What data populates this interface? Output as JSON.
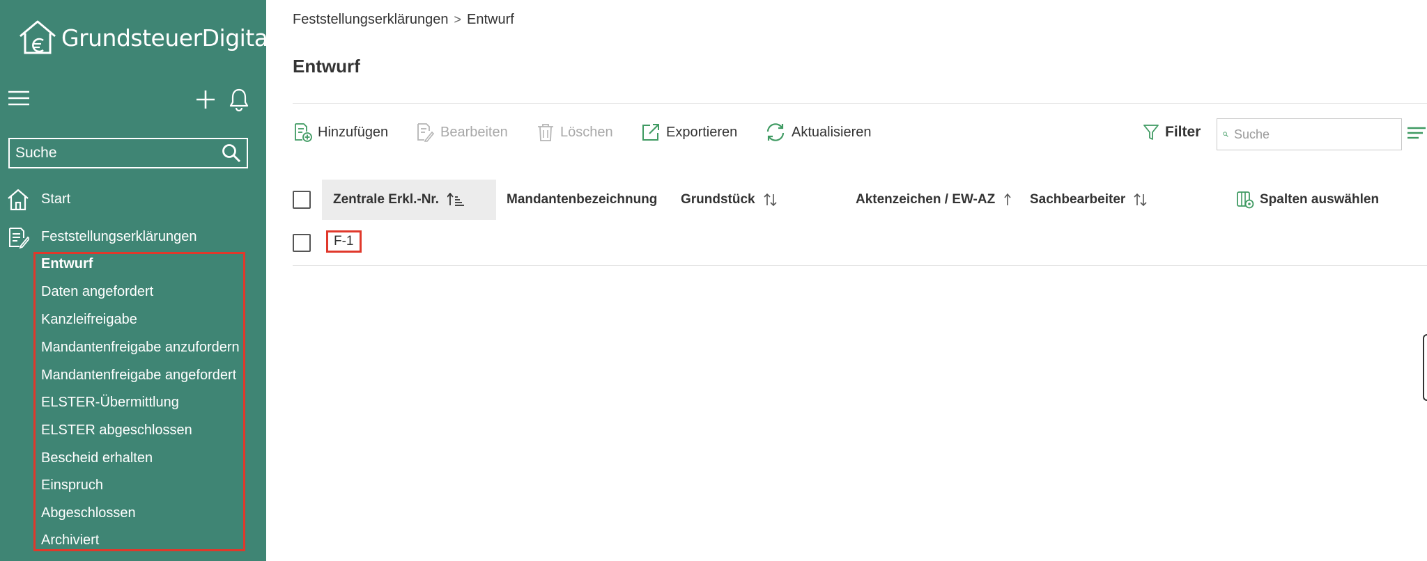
{
  "app": {
    "logo_text": "GrundsteuerDigital"
  },
  "sidebar": {
    "search_placeholder": "Suche",
    "nav": [
      {
        "label": "Start",
        "icon": "home-icon"
      },
      {
        "label": "Feststellungserklärungen",
        "icon": "document-edit-icon"
      }
    ],
    "sub_items": [
      "Entwurf",
      "Daten angefordert",
      "Kanzleifreigabe",
      "Mandantenfreigabe anzufordern",
      "Mandantenfreigabe angefordert",
      "ELSTER-Übermittlung",
      "ELSTER abgeschlossen",
      "Bescheid erhalten",
      "Einspruch",
      "Abgeschlossen",
      "Archiviert"
    ],
    "active_sub_item": "Entwurf"
  },
  "breadcrumb": {
    "parent": "Feststellungserklärungen",
    "separator": ">",
    "current": "Entwurf"
  },
  "page": {
    "title": "Entwurf"
  },
  "toolbar": {
    "add": "Hinzufügen",
    "edit": "Bearbeiten",
    "delete": "Löschen",
    "export": "Exportieren",
    "refresh": "Aktualisieren",
    "filter": "Filter",
    "search_placeholder": "Suche"
  },
  "table": {
    "columns": [
      "Zentrale Erkl.-Nr.",
      "Mandantenbezeichnung",
      "Grundstück",
      "Aktenzeichen / EW-AZ",
      "Sachbearbeiter"
    ],
    "column_picker": "Spalten auswählen",
    "rows": [
      {
        "id": "F-1"
      }
    ]
  },
  "colors": {
    "sidebar_bg": "#3f8574",
    "accent_green": "#3f9a62",
    "highlight_red": "#e0382b"
  }
}
